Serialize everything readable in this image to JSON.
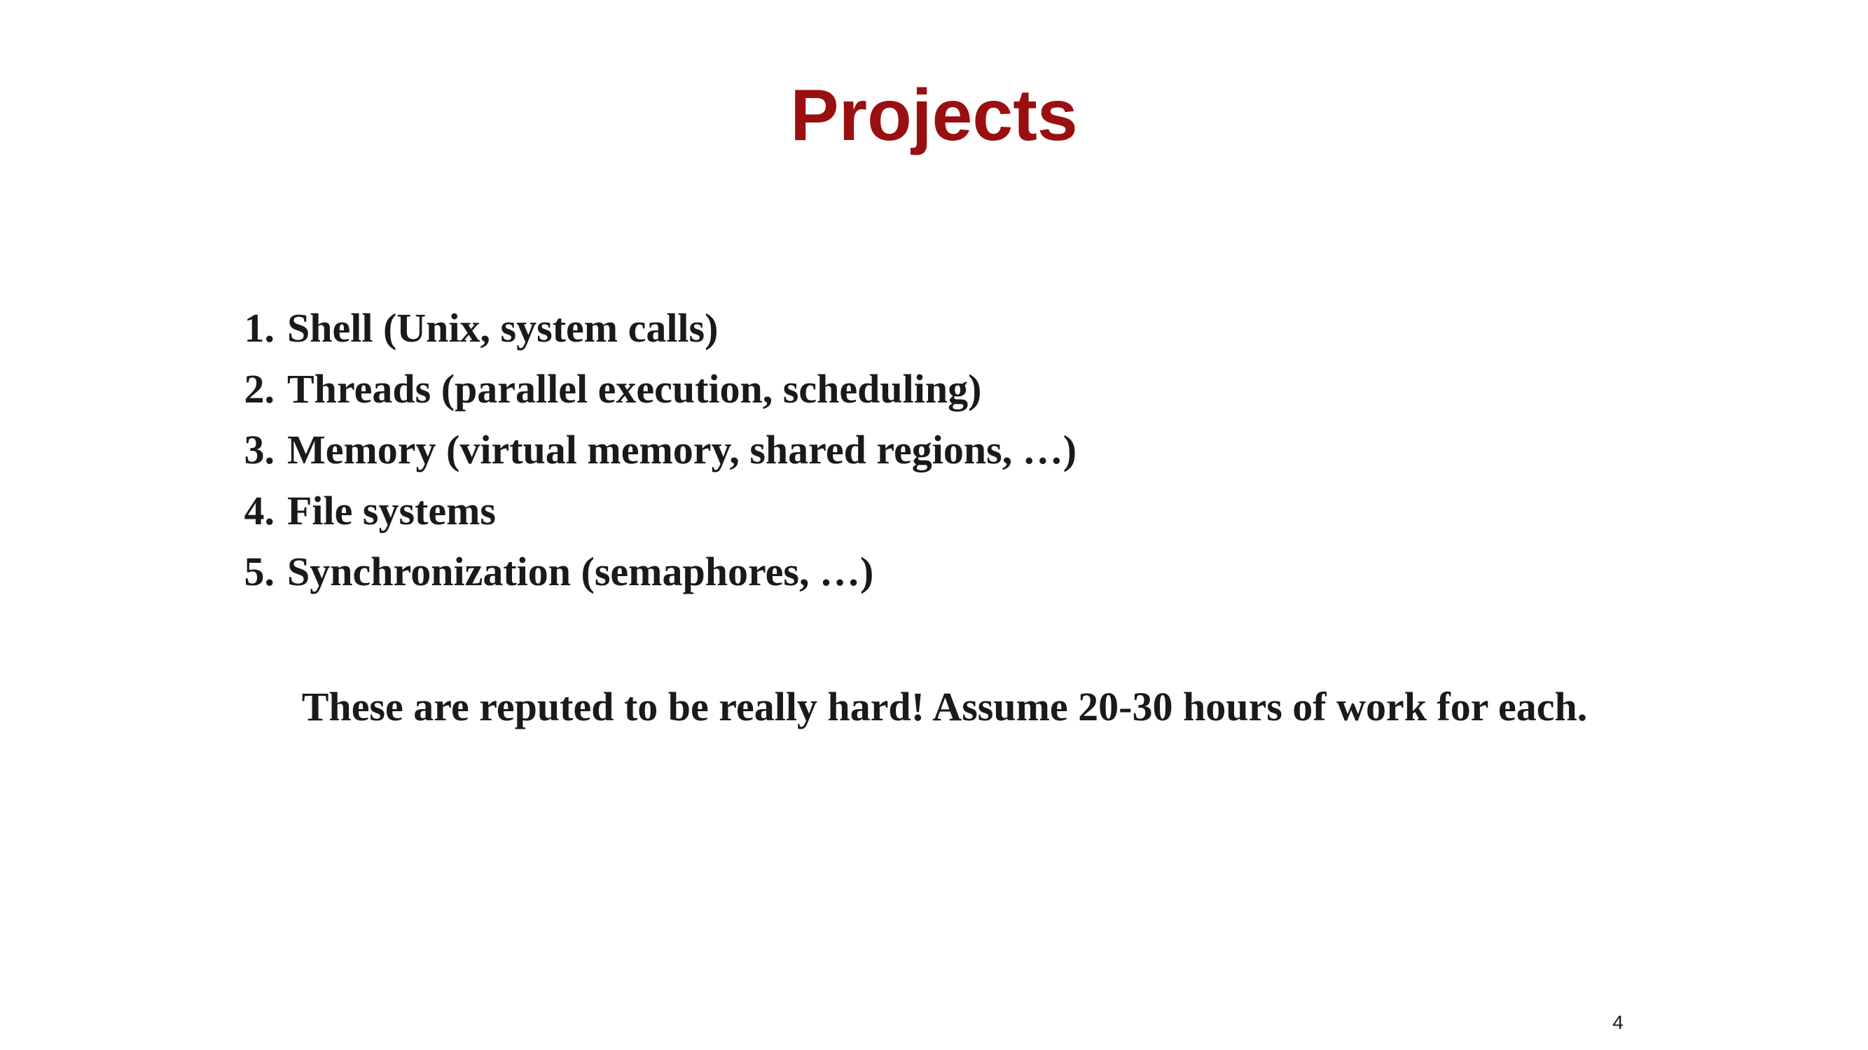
{
  "slide": {
    "title": "Projects",
    "title_color": "#9a0f0f",
    "projects": [
      {
        "number": "1.",
        "text": "Shell (Unix, system calls)"
      },
      {
        "number": "2.",
        "text": "Threads (parallel execution, scheduling)"
      },
      {
        "number": "3.",
        "text": "Memory (virtual memory, shared regions, …)"
      },
      {
        "number": "4.",
        "text": "File systems"
      },
      {
        "number": "5.",
        "text": "Synchronization (semaphores, …)"
      }
    ],
    "note": "These are reputed to be really hard! Assume 20-30 hours of work for each.",
    "page_number": "4"
  }
}
